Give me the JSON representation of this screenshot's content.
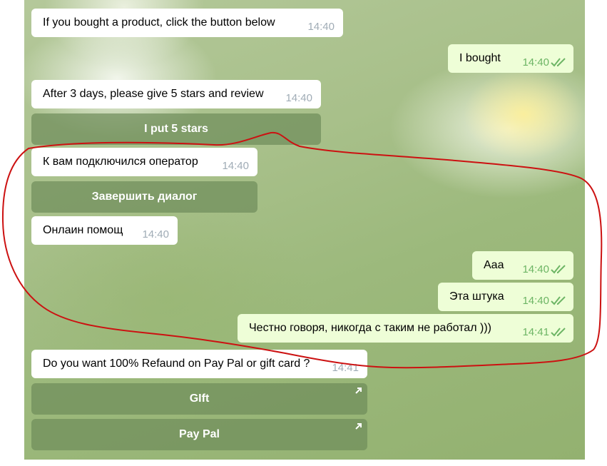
{
  "messages": [
    {
      "id": "m1",
      "dir": "in",
      "text": "If you bought a product, click the button below",
      "time": "14:40"
    },
    {
      "id": "m2",
      "dir": "out",
      "text": "I bought",
      "time": "14:40"
    },
    {
      "id": "m3",
      "dir": "in",
      "text": "After 3 days, please give 5 stars and review",
      "time": "14:40"
    },
    {
      "id": "m4",
      "dir": "in",
      "text": "К вам подключился оператор",
      "time": "14:40"
    },
    {
      "id": "m5",
      "dir": "in",
      "text": "Онлаин помощ",
      "time": "14:40"
    },
    {
      "id": "m6",
      "dir": "out",
      "text": "Aaa",
      "time": "14:40"
    },
    {
      "id": "m7",
      "dir": "out",
      "text": "Эта штука",
      "time": "14:40"
    },
    {
      "id": "m8",
      "dir": "out",
      "text": "Честно говоря, никогда с таким не работал )))",
      "time": "14:41"
    },
    {
      "id": "m9",
      "dir": "in",
      "text": "Do you want 100% Refaund on Pay Pal or gift card ?",
      "time": "14:41"
    }
  ],
  "buttons": {
    "put_5_stars": "I put 5 stars",
    "end_dialog": "Завершить диалог",
    "gift": "GIft",
    "paypal": "Pay Pal"
  },
  "colors": {
    "incoming_bubble": "#ffffff",
    "outgoing_bubble": "#eefed7",
    "read_check": "#6db565",
    "keyboard_button": "#6e8c5a",
    "annotation": "#cc1111"
  },
  "icons": {
    "read_receipt": "double-check-icon",
    "url_button": "arrow-up-right-icon"
  }
}
